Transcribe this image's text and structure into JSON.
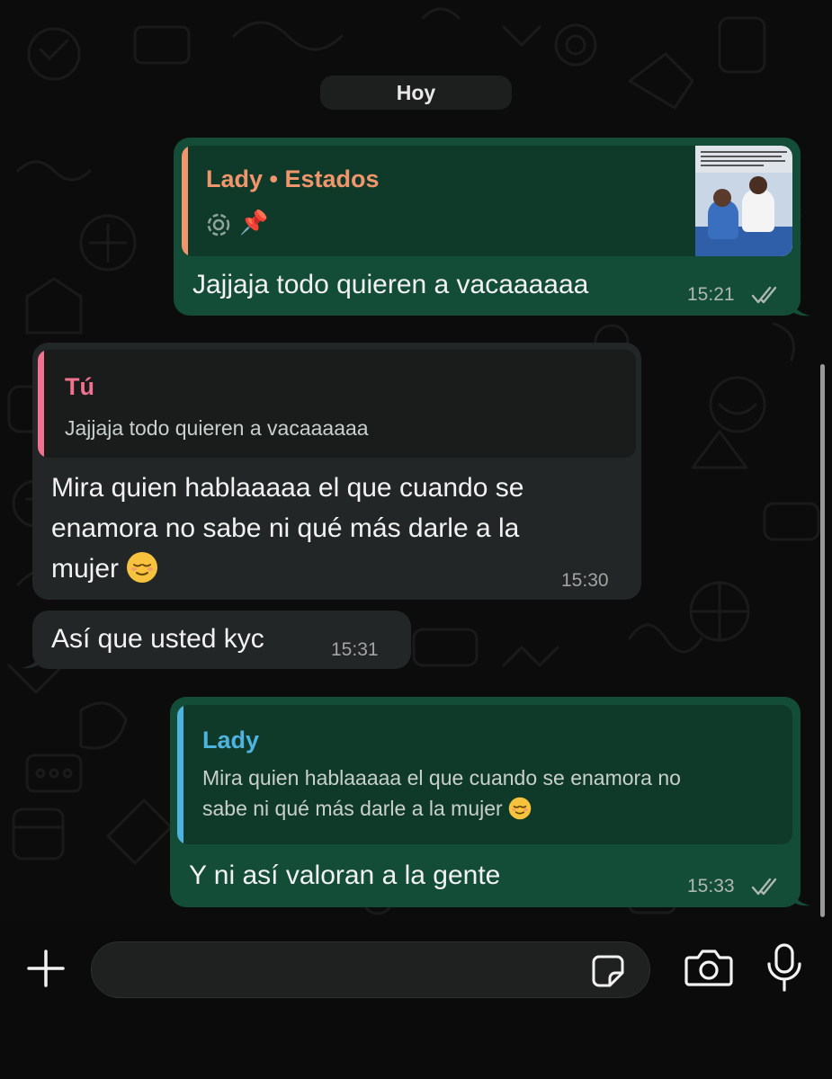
{
  "date_separator": "Hoy",
  "messages": [
    {
      "direction": "outgoing",
      "reply_to": {
        "author": "Lady • Estados",
        "status_icon": "status-ring-icon",
        "pin_emoji": "📌",
        "has_thumbnail": true
      },
      "text": "Jajjaja todo quieren a vacaaaaaa",
      "time": "15:21",
      "read": true
    },
    {
      "direction": "incoming",
      "reply_to": {
        "author": "Tú",
        "text": "Jajjaja todo quieren a vacaaaaaa"
      },
      "text_lines": [
        "Mira quien hablaaaaa el que cuando se",
        "enamora no sabe ni qué más darle a la",
        "mujer"
      ],
      "emoji": "😌",
      "time": "15:30"
    },
    {
      "direction": "incoming",
      "text": "Así que usted kyc",
      "time": "15:31"
    },
    {
      "direction": "outgoing",
      "reply_to": {
        "author": "Lady",
        "text_lines": [
          "Mira quien hablaaaaa el que cuando se enamora no",
          "sabe ni qué más darle a la mujer"
        ],
        "emoji": "😌"
      },
      "text": "Y ni así valoran a la gente",
      "time": "15:33",
      "read": true
    }
  ],
  "composer": {
    "placeholder": "",
    "icons": [
      "plus-icon",
      "sticker-icon",
      "camera-icon",
      "microphone-icon"
    ]
  },
  "colors": {
    "outgoing_bubble": "#144d37",
    "incoming_bubble": "#232626",
    "estados_author": "#f0966c",
    "tu_author": "#f2718f",
    "lady_author": "#4fb3e0"
  }
}
